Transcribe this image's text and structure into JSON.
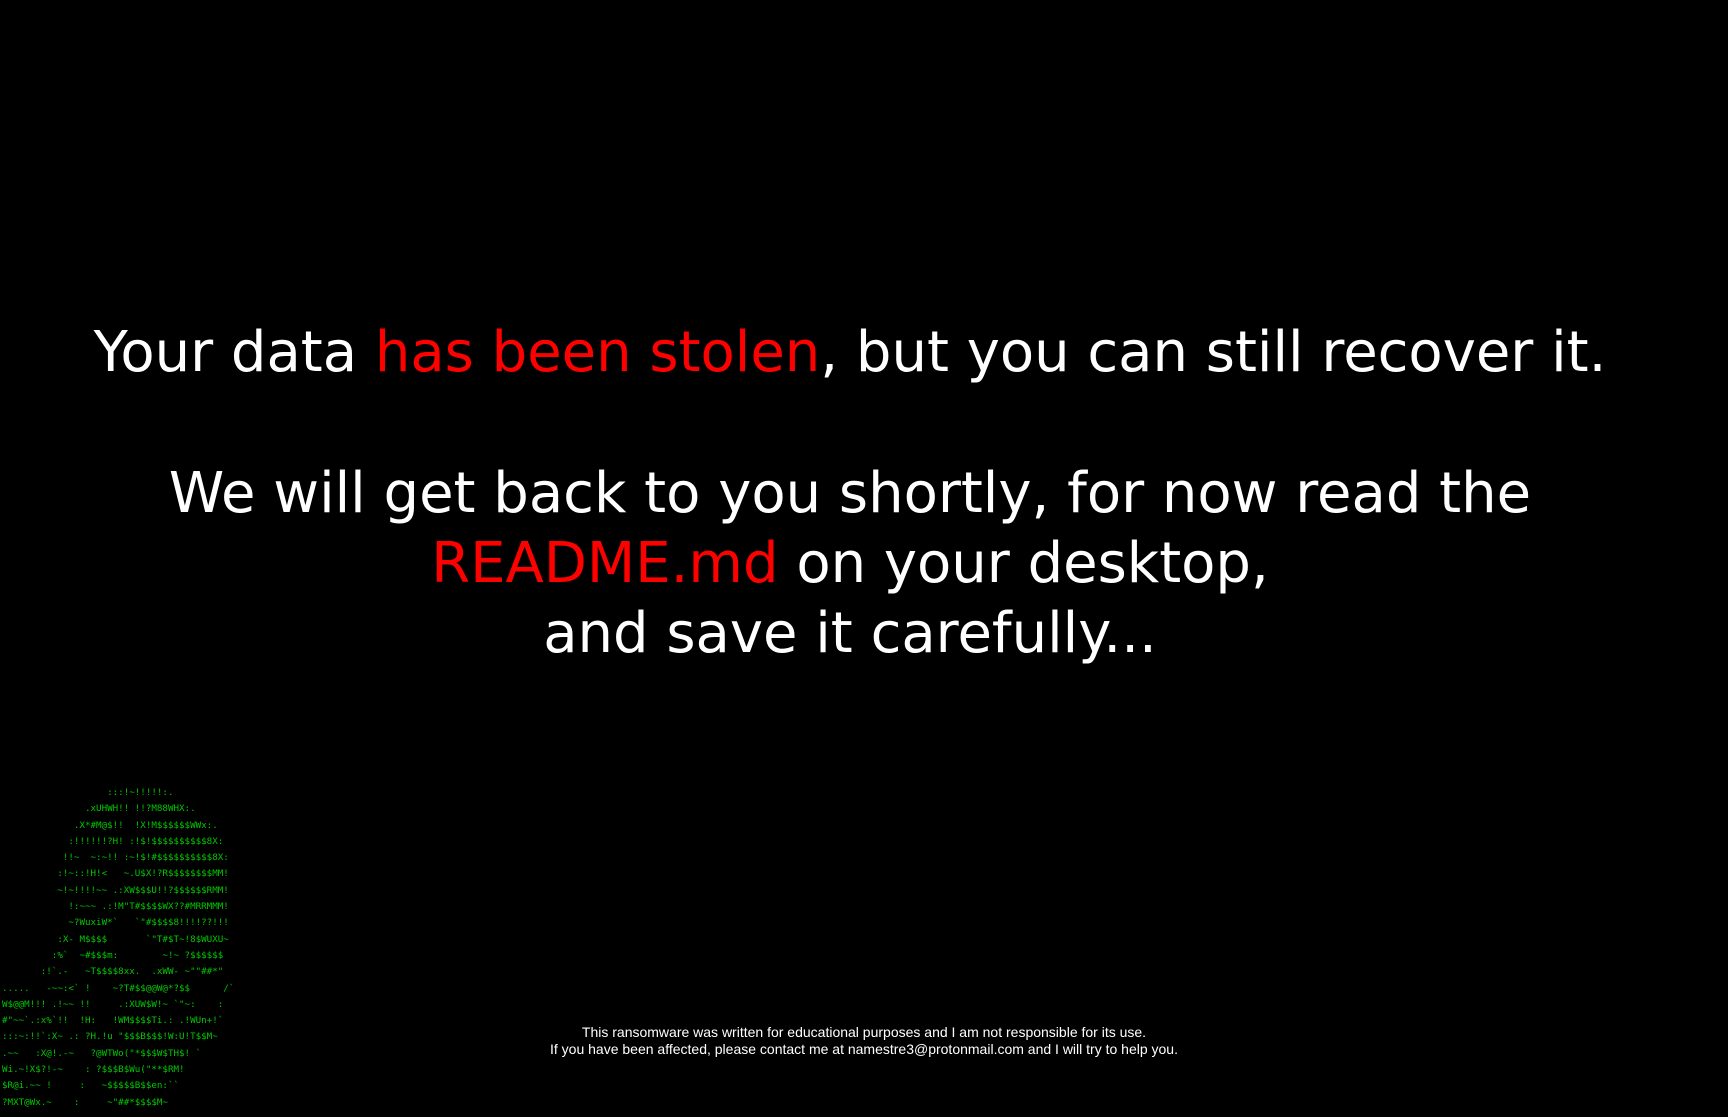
{
  "colors": {
    "background": "#000000",
    "text": "#ffffff",
    "accent": "#ff0000",
    "ascii": "#00c800"
  },
  "message": {
    "line1": {
      "before": "Your data ",
      "highlight": "has been stolen",
      "after": ", but you can still recover it."
    },
    "line2": "We will get back to you shortly, for now read the",
    "line3": {
      "highlight": "README.md",
      "after": " on your desktop,"
    },
    "line4": "and save it carefully..."
  },
  "ascii_art": "                   :::!~!!!!!:.\n               .xUHWH!! !!?M88WHX:.\n             .X*#M@$!!  !X!M$$$$$$WWx:.\n            :!!!!!!?H! :!$!$$$$$$$$$$8X:\n           !!~  ~:~!! :~!$!#$$$$$$$$$$8X:\n          :!~::!H!<   ~.U$X!?R$$$$$$$$MM!\n          ~!~!!!!~~ .:XW$$$U!!?$$$$$$RMM!\n            !:~~~ .:!M\"T#$$$$WX??#MRRMMM!\n            ~?WuxiW*`   `\"#$$$$8!!!!??!!!\n          :X- M$$$$       `\"T#$T~!8$WUXU~\n         :%`  ~#$$$m:        ~!~ ?$$$$$$\n       :!`.-   ~T$$$$8xx.  .xWW- ~\"\"##*\"\n.....   -~~:<` !    ~?T#$$@@W@*?$$      /`\nW$@@M!!! .!~~ !!     .:XUW$W!~ `\"~:    :\n#\"~~`.:x%`!!  !H:   !WM$$$$Ti.: .!WUn+!`\n:::~:!!`:X~ .: ?H.!u \"$$$B$$$!W:U!T$$M~\n.~~   :X@!.-~   ?@WTWo(\"*$$$W$TH$! `\nWi.~!X$?!-~    : ?$$$B$Wu(\"**$RM!\n$R@i.~~ !     :   ~$$$$$B$$en:``\n?MXT@Wx.~    :     ~\"##*$$$$M~",
  "disclaimer": {
    "line1": "This ransomware was written for educational purposes and I am not responsible for its use.",
    "line2": "If you have been affected, please contact me at namestre3@protonmail.com and I will try to help you."
  }
}
